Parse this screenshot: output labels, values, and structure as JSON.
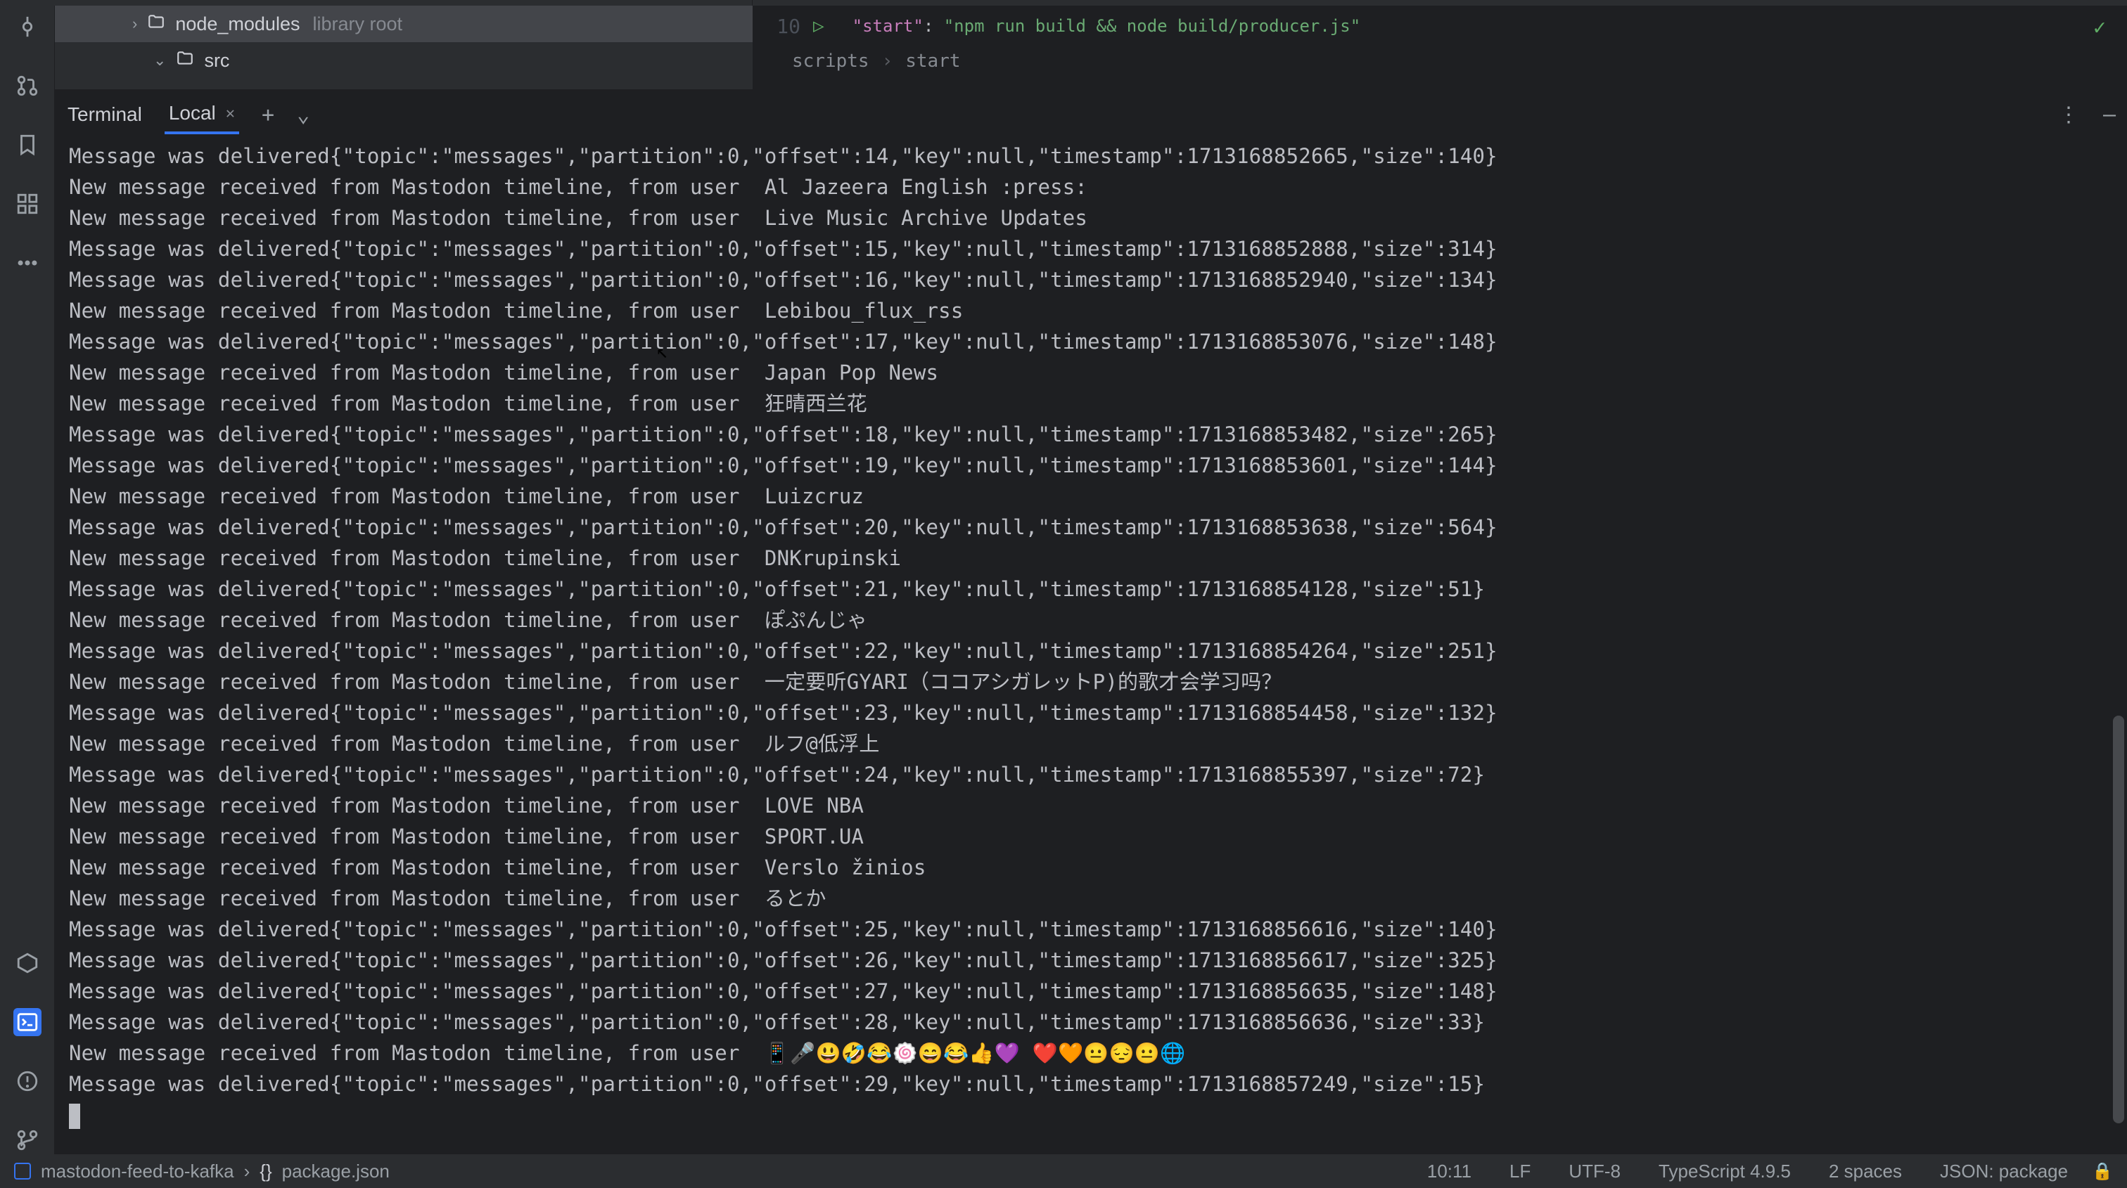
{
  "tree": {
    "node_modules": {
      "name": "node_modules",
      "hint": "library root"
    },
    "src": {
      "name": "src"
    }
  },
  "editor": {
    "line_number": "10",
    "code_key": "\"start\"",
    "code_sep": ": ",
    "code_val": "\"npm run build && node build/producer.js\"",
    "breadcrumb": [
      "scripts",
      "start"
    ]
  },
  "terminal": {
    "title": "Terminal",
    "tab": "Local",
    "lines": [
      "Message was delivered{\"topic\":\"messages\",\"partition\":0,\"offset\":14,\"key\":null,\"timestamp\":1713168852665,\"size\":140}",
      "New message received from Mastodon timeline, from user  Al Jazeera English :press:",
      "New message received from Mastodon timeline, from user  Live Music Archive Updates",
      "Message was delivered{\"topic\":\"messages\",\"partition\":0,\"offset\":15,\"key\":null,\"timestamp\":1713168852888,\"size\":314}",
      "Message was delivered{\"topic\":\"messages\",\"partition\":0,\"offset\":16,\"key\":null,\"timestamp\":1713168852940,\"size\":134}",
      "New message received from Mastodon timeline, from user  Lebibou_flux_rss",
      "Message was delivered{\"topic\":\"messages\",\"partition\":0,\"offset\":17,\"key\":null,\"timestamp\":1713168853076,\"size\":148}",
      "New message received from Mastodon timeline, from user  Japan Pop News",
      "New message received from Mastodon timeline, from user  狂晴西兰花",
      "Message was delivered{\"topic\":\"messages\",\"partition\":0,\"offset\":18,\"key\":null,\"timestamp\":1713168853482,\"size\":265}",
      "Message was delivered{\"topic\":\"messages\",\"partition\":0,\"offset\":19,\"key\":null,\"timestamp\":1713168853601,\"size\":144}",
      "New message received from Mastodon timeline, from user  Luizcruz",
      "Message was delivered{\"topic\":\"messages\",\"partition\":0,\"offset\":20,\"key\":null,\"timestamp\":1713168853638,\"size\":564}",
      "New message received from Mastodon timeline, from user  DNKrupinski",
      "Message was delivered{\"topic\":\"messages\",\"partition\":0,\"offset\":21,\"key\":null,\"timestamp\":1713168854128,\"size\":51}",
      "New message received from Mastodon timeline, from user  ぽぷんじゃ",
      "Message was delivered{\"topic\":\"messages\",\"partition\":0,\"offset\":22,\"key\":null,\"timestamp\":1713168854264,\"size\":251}",
      "New message received from Mastodon timeline, from user  一定要听GYARI（ココアシガレットP)的歌才会学习吗？",
      "Message was delivered{\"topic\":\"messages\",\"partition\":0,\"offset\":23,\"key\":null,\"timestamp\":1713168854458,\"size\":132}",
      "New message received from Mastodon timeline, from user  ルフ@低浮上",
      "Message was delivered{\"topic\":\"messages\",\"partition\":0,\"offset\":24,\"key\":null,\"timestamp\":1713168855397,\"size\":72}",
      "New message received from Mastodon timeline, from user  LOVE NBA",
      "New message received from Mastodon timeline, from user  SPORT.UA",
      "New message received from Mastodon timeline, from user  Verslo žinios",
      "New message received from Mastodon timeline, from user  るとか",
      "Message was delivered{\"topic\":\"messages\",\"partition\":0,\"offset\":25,\"key\":null,\"timestamp\":1713168856616,\"size\":140}",
      "Message was delivered{\"topic\":\"messages\",\"partition\":0,\"offset\":26,\"key\":null,\"timestamp\":1713168856617,\"size\":325}",
      "Message was delivered{\"topic\":\"messages\",\"partition\":0,\"offset\":27,\"key\":null,\"timestamp\":1713168856635,\"size\":148}",
      "Message was delivered{\"topic\":\"messages\",\"partition\":0,\"offset\":28,\"key\":null,\"timestamp\":1713168856636,\"size\":33}",
      "New message received from Mastodon timeline, from user  📱🎤😃🤣😂🍥😄😂👍💜 ❤️🧡😐😔😐🌐",
      "Message was delivered{\"topic\":\"messages\",\"partition\":0,\"offset\":29,\"key\":null,\"timestamp\":1713168857249,\"size\":15}"
    ]
  },
  "statusbar": {
    "project": "mastodon-feed-to-kafka",
    "file": "package.json",
    "pos": "10:11",
    "eol": "LF",
    "enc": "UTF-8",
    "lang": "TypeScript 4.9.5",
    "indent": "2 spaces",
    "schema": "JSON: package"
  }
}
